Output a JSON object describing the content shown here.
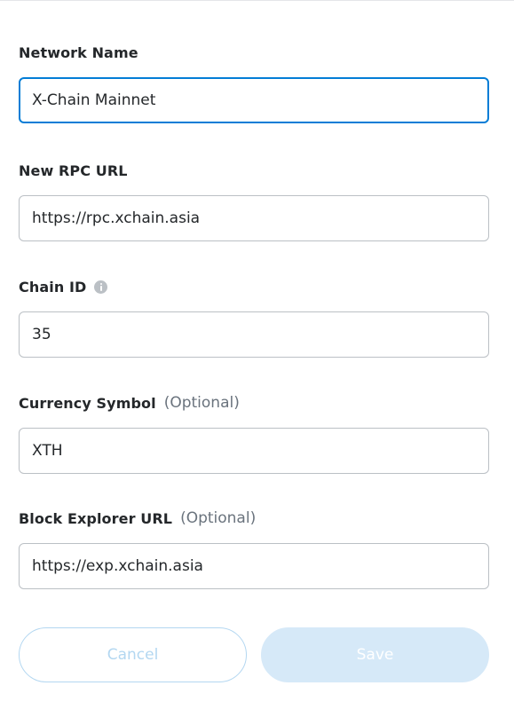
{
  "form": {
    "network_name": {
      "label": "Network Name",
      "value": "X-Chain Mainnet"
    },
    "rpc_url": {
      "label": "New RPC URL",
      "value": "https://rpc.xchain.asia"
    },
    "chain_id": {
      "label": "Chain ID",
      "value": "35",
      "info_icon": "info-icon"
    },
    "currency_symbol": {
      "label": "Currency Symbol",
      "optional": "(Optional)",
      "value": "XTH"
    },
    "block_explorer": {
      "label": "Block Explorer URL",
      "optional": "(Optional)",
      "value": "https://exp.xchain.asia"
    }
  },
  "actions": {
    "cancel_label": "Cancel",
    "save_label": "Save"
  },
  "colors": {
    "focus_border": "#037dd6",
    "input_border": "#bbc0c5",
    "disabled_button_bg": "#d6e9f8",
    "disabled_button_outline": "#b3d7f1"
  }
}
